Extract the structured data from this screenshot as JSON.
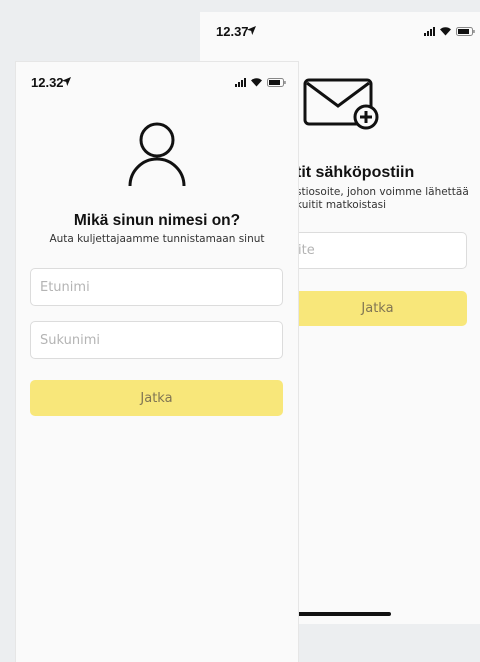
{
  "back_screen": {
    "status_time": "12.37",
    "title": "tit sähköpostiin",
    "subtitle_line1": "stiosoite, johon voimme lähettää",
    "subtitle_line2": "kuitit matkoistasi",
    "email_placeholder": "ite",
    "continue_label": "Jatka"
  },
  "front_screen": {
    "status_time": "12.32",
    "title": "Mikä sinun nimesi on?",
    "subtitle": "Auta kuljettajaamme tunnistamaan sinut",
    "first_name_placeholder": "Etunimi",
    "last_name_placeholder": "Sukunimi",
    "continue_label": "Jatka"
  },
  "colors": {
    "button": "#f8e77a",
    "button_text": "#807554",
    "background": "#fafafa"
  },
  "icons": [
    "location-arrow-icon",
    "cellular-signal-icon",
    "wifi-icon",
    "battery-icon",
    "envelope-plus-icon",
    "person-icon"
  ]
}
